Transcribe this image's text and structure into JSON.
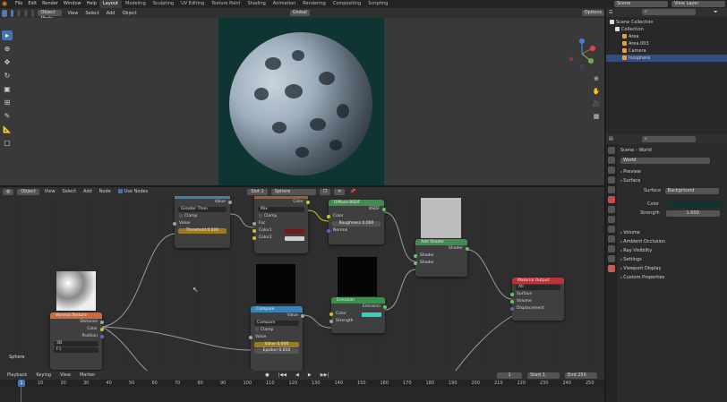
{
  "topbar": {
    "menus": [
      "File",
      "Edit",
      "Render",
      "Window",
      "Help"
    ],
    "workspaces": [
      "Layout",
      "Modeling",
      "Sculpting",
      "UV Editing",
      "Texture Paint",
      "Shading",
      "Animation",
      "Rendering",
      "Compositing",
      "Scripting"
    ],
    "active_workspace": "Layout",
    "scene": "Scene",
    "view_layer": "View Layer"
  },
  "viewport": {
    "mode": "Object Mode",
    "menus": [
      "View",
      "Select",
      "Add",
      "Object"
    ],
    "orientation": "Global",
    "options": "Options"
  },
  "node_editor": {
    "type": "Object",
    "menus": [
      "View",
      "Select",
      "Add",
      "Node"
    ],
    "use_nodes": "Use Nodes",
    "slot": "Slot 1",
    "material": "Sphere",
    "object_label": "Sphere",
    "nodes": {
      "math": {
        "value_label": "Value",
        "operation": "Greater Than",
        "clamp": "Clamp",
        "value_in": "Value",
        "threshold": "Threshold  0.000"
      },
      "mix": {
        "color_out": "Color",
        "blend": "Mix",
        "clamp": "Clamp",
        "fac": "Fac",
        "color1": "Color1",
        "color2": "Color2",
        "color1_hex": "#6b1c1c",
        "color2_hex": "#cfcfcf"
      },
      "diffuse": {
        "title": "Diffuse BSDF",
        "bsdf": "BSDF",
        "color": "Color",
        "roughness": "Roughness  0.000",
        "normal": "Normal"
      },
      "add_shader": {
        "title": "Add Shader",
        "shader_out": "Shader",
        "shader1": "Shader",
        "shader2": "Shader"
      },
      "emission": {
        "title": "Emission",
        "emission_out": "Emission",
        "color": "Color",
        "strength": "Strength",
        "color_hex": "#35d1c0"
      },
      "voronoi": {
        "title": "Voronoi Texture",
        "distance": "Distance",
        "color": "Color",
        "position": "Position",
        "dim": "3D",
        "feature": "F1"
      },
      "compare": {
        "title": "Compare",
        "value_out": "Value",
        "operation": "Compare",
        "clamp": "Clamp",
        "value": "Value",
        "value_field": "Value    0.000",
        "epsilon": "Epsilon    0.010"
      },
      "output": {
        "title": "Material Output",
        "target": "All",
        "surface": "Surface",
        "volume": "Volume",
        "displacement": "Displacement"
      }
    }
  },
  "timeline": {
    "menus": [
      "Playback",
      "Keying",
      "View",
      "Marker"
    ],
    "current_frame": "1",
    "start_label": "Start",
    "start": "1",
    "end_label": "End",
    "end": "250",
    "ticks": [
      "1",
      "10",
      "20",
      "30",
      "40",
      "50",
      "60",
      "70",
      "80",
      "90",
      "100",
      "110",
      "120",
      "130",
      "140",
      "150",
      "160",
      "170",
      "180",
      "190",
      "200",
      "210",
      "220",
      "230",
      "240",
      "250"
    ]
  },
  "outliner": {
    "root": "Scene Collection",
    "collection": "Collection",
    "items": [
      "Area",
      "Area.003",
      "Camera",
      "Icosphere"
    ],
    "selected": "Icosphere"
  },
  "properties": {
    "scene_tab": "Scene",
    "world_tab": "World",
    "world_name": "World",
    "preview": "Preview",
    "surface": "Surface",
    "surface_label": "Surface",
    "surface_value": "Background",
    "color_label": "Color",
    "strength_label": "Strength",
    "strength_value": "1.000",
    "sections": [
      "Volume",
      "Ambient Occlusion",
      "Ray Visibility",
      "Settings",
      "Viewport Display",
      "Custom Properties"
    ]
  }
}
